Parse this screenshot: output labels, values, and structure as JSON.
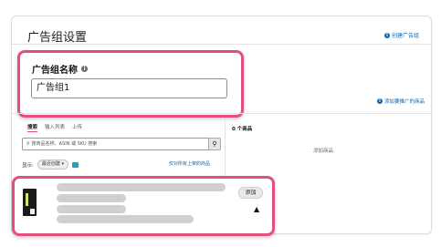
{
  "header": {
    "title": "广告组设置",
    "create_link": "创建广告组"
  },
  "ad_group_name": {
    "label": "广告组名称",
    "value": "广告组1"
  },
  "products": {
    "add_link": "添加要推广的商品",
    "tabs": [
      "搜索",
      "输入列表",
      "上传"
    ],
    "count_label": "0 个商品",
    "search_placeholder": "按商品名称、ASIN 或 SKU 搜索",
    "empty_label": "添加商品",
    "filter_label": "显示:",
    "filter_value": "最近创建",
    "filter_link": "仅对所有上架的商品",
    "add_button": "添加",
    "warning_icon": "warning-icon"
  },
  "colors": {
    "highlight": "#e3517a",
    "link": "#0a66b0"
  }
}
